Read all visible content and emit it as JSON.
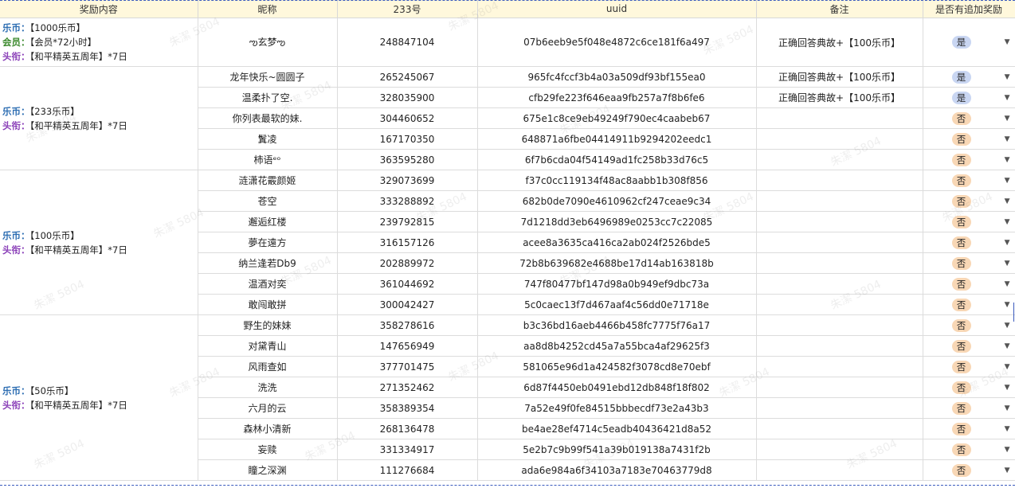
{
  "headers": [
    "奖励内容",
    "昵称",
    "233号",
    "uuid",
    "备注",
    "是否有追加奖励"
  ],
  "groups": [
    {
      "reward": [
        {
          "label": "乐币：",
          "value": "【1000乐币】",
          "color": "blue"
        },
        {
          "label": "会员：",
          "value": "【会员*72小时】",
          "color": "green"
        },
        {
          "label": "头衔：",
          "value": "【和平精英五周年】*7日",
          "color": "purple"
        }
      ]
    },
    {
      "reward": [
        {
          "label": "乐币：",
          "value": "【233乐币】",
          "color": "blue"
        },
        {
          "label": "头衔：",
          "value": "【和平精英五周年】*7日",
          "color": "purple"
        }
      ]
    },
    {
      "reward": [
        {
          "label": "乐币：",
          "value": "【100乐币】",
          "color": "blue"
        },
        {
          "label": "头衔：",
          "value": "【和平精英五周年】*7日",
          "color": "purple"
        }
      ]
    },
    {
      "reward": [
        {
          "label": "乐币：",
          "value": "【50乐币】",
          "color": "blue"
        },
        {
          "label": "头衔：",
          "value": "【和平精英五周年】*7日",
          "color": "purple"
        }
      ]
    }
  ],
  "rows": [
    {
      "nick": "ఌ玄梦ఌ",
      "id": "248847104",
      "uuid": "07b6eeb9e5f048e4872c6ce181f6a497",
      "note": "正确回答典故+【100乐币】",
      "extra": "是"
    },
    {
      "nick": "龙年快乐~圆圆子",
      "id": "265245067",
      "uuid": "965fc4fccf3b4a03a509df93bf155ea0",
      "note": "正确回答典故+【100乐币】",
      "extra": "是"
    },
    {
      "nick": "温柔扑了空.",
      "id": "328035900",
      "uuid": "cfb29fe223f646eaa9fb257a7f8b6fe6",
      "note": "正确回答典故+【100乐币】",
      "extra": "是"
    },
    {
      "nick": "你列表最软的妹.",
      "id": "304460652",
      "uuid": "675e1c8ce9eb49249f790ec4caabeb67",
      "note": "",
      "extra": "否"
    },
    {
      "nick": "鬒凌",
      "id": "167170350",
      "uuid": "648871a6fbe04414911b9294202eedc1",
      "note": "",
      "extra": "否"
    },
    {
      "nick": "柿语ᵉᵒ",
      "id": "363595280",
      "uuid": "6f7b6cda04f54149ad1fc258b33d76c5",
      "note": "",
      "extra": "否"
    },
    {
      "nick": "涟潇花霰颜姬",
      "id": "329073699",
      "uuid": "f37c0cc119134f48ac8aabb1b308f856",
      "note": "",
      "extra": "否"
    },
    {
      "nick": "苍空",
      "id": "333288892",
      "uuid": "682b0de7090e4610962cf247ceae9c34",
      "note": "",
      "extra": "否"
    },
    {
      "nick": "邂逅红楼",
      "id": "239792815",
      "uuid": "7d1218dd3eb6496989e0253cc7c22085",
      "note": "",
      "extra": "否"
    },
    {
      "nick": "夢在遠方",
      "id": "316157126",
      "uuid": "acee8a3635ca416ca2ab024f2526bde5",
      "note": "",
      "extra": "否"
    },
    {
      "nick": "纳兰逢若Db9",
      "id": "202889972",
      "uuid": "72b8b639682e4688be17d14ab163818b",
      "note": "",
      "extra": "否"
    },
    {
      "nick": "温酒对奕",
      "id": "361044692",
      "uuid": "747f80477bf147d98a0b949ef9dbc73a",
      "note": "",
      "extra": "否"
    },
    {
      "nick": "敢闯敢拼",
      "id": "300042427",
      "uuid": "5c0caec13f7d467aaf4c56dd0e71718e",
      "note": "",
      "extra": "否"
    },
    {
      "nick": "野生的妹妹",
      "id": "358278616",
      "uuid": "b3c36bd16aeb4466b458fc7775f76a17",
      "note": "",
      "extra": "否"
    },
    {
      "nick": "对黛青山",
      "id": "147656949",
      "uuid": "aa8d8b4252cd45a7a55bca4af29625f3",
      "note": "",
      "extra": "否"
    },
    {
      "nick": "风雨查如",
      "id": "377701475",
      "uuid": "581065e96d1a424582f3078cd8e70ebf",
      "note": "",
      "extra": "否"
    },
    {
      "nick": "洗洗",
      "id": "271352462",
      "uuid": "6d87f4450eb0491ebd12db848f18f802",
      "note": "",
      "extra": "否"
    },
    {
      "nick": "六月的云",
      "id": "358389354",
      "uuid": "7a52e49f0fe84515bbbecdf73e2a43b3",
      "note": "",
      "extra": "否"
    },
    {
      "nick": "森林小清新",
      "id": "268136478",
      "uuid": "be4ae28ef4714c5eadb40436421d8a52",
      "note": "",
      "extra": "否"
    },
    {
      "nick": "妄赎",
      "id": "331334917",
      "uuid": "5e2b7c9b99f541a39b019138a7431f2b",
      "note": "",
      "extra": "否"
    },
    {
      "nick": "瞳之深渊",
      "id": "111276684",
      "uuid": "ada6e984a6f34103a7183e70463779d8",
      "note": "",
      "extra": "否"
    }
  ],
  "watermark": "朱潔 5804",
  "colors": {
    "header_bg": "#fff8dc",
    "yes_badge": "#c9d6f2",
    "no_badge": "#f8d7b5",
    "blue": "#2f6fb3",
    "green": "#3c8a2e",
    "purple": "#8a3fb8"
  }
}
